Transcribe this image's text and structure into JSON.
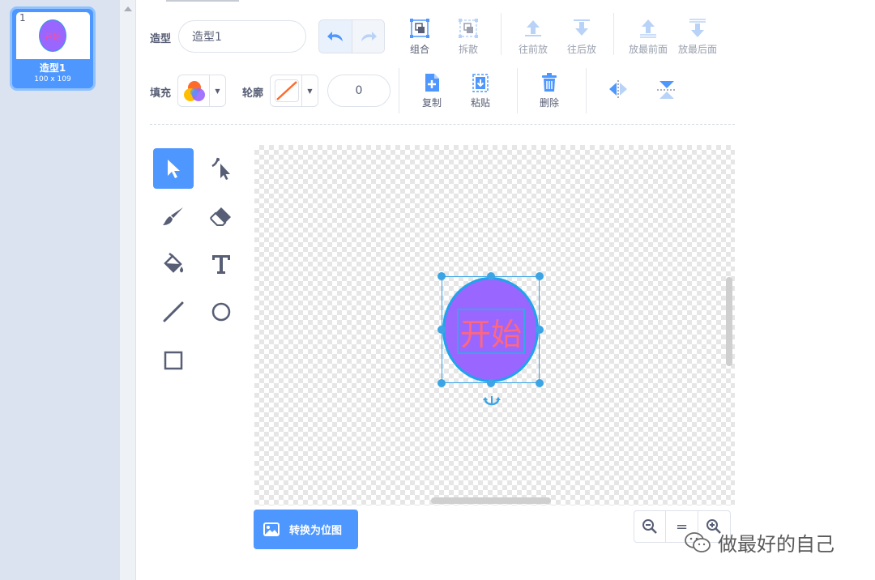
{
  "costume_list": {
    "items": [
      {
        "number": "1",
        "thumb_text": "开始",
        "name": "造型1",
        "size": "100 x 109"
      }
    ]
  },
  "toolbar": {
    "costume_label": "造型",
    "costume_name_value": "造型1",
    "group_label": "组合",
    "ungroup_label": "拆散",
    "forward_label": "往前放",
    "backward_label": "往后放",
    "front_label": "放最前面",
    "back_label": "放最后面",
    "fill_label": "填充",
    "outline_label": "轮廓",
    "outline_width": "0",
    "copy_label": "复制",
    "paste_label": "粘贴",
    "delete_label": "删除"
  },
  "canvas": {
    "shape_text": "开始",
    "colors": {
      "fill": "#9966ff",
      "outline": "#1fa3ea",
      "text": "#ff6680",
      "accent": "#4d97ff"
    }
  },
  "bottom": {
    "convert_label": "转换为位图",
    "zoom_reset_label": "="
  },
  "watermark": {
    "text": "做最好的自己"
  }
}
